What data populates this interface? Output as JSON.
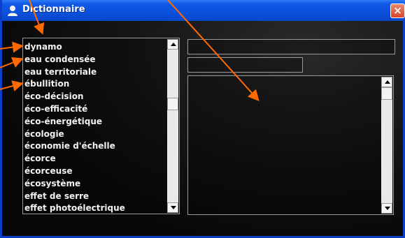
{
  "window": {
    "title": "Dictionnaire",
    "close_symbol": "×"
  },
  "icons": {
    "app": "user-icon",
    "close": "close-icon",
    "scroll_up": "arrow-up-icon",
    "scroll_down": "arrow-down-icon"
  },
  "word_list": {
    "items": [
      "dynamo",
      "eau condensée",
      "eau territoriale",
      "ébullition",
      "éco-décision",
      "éco-efficacité",
      "éco-énergétique",
      "écologie",
      "économie d'échelle",
      "écorce",
      "écorceuse",
      "écosystème",
      "effet de serre",
      "effet photoélectrique"
    ]
  },
  "fields": {
    "term_value": "",
    "short_value": "",
    "definition_value": ""
  },
  "colors": {
    "titlebar": "#0a4fd8",
    "annotation_arrow": "#ff6a00",
    "close_button": "#d9442a"
  }
}
